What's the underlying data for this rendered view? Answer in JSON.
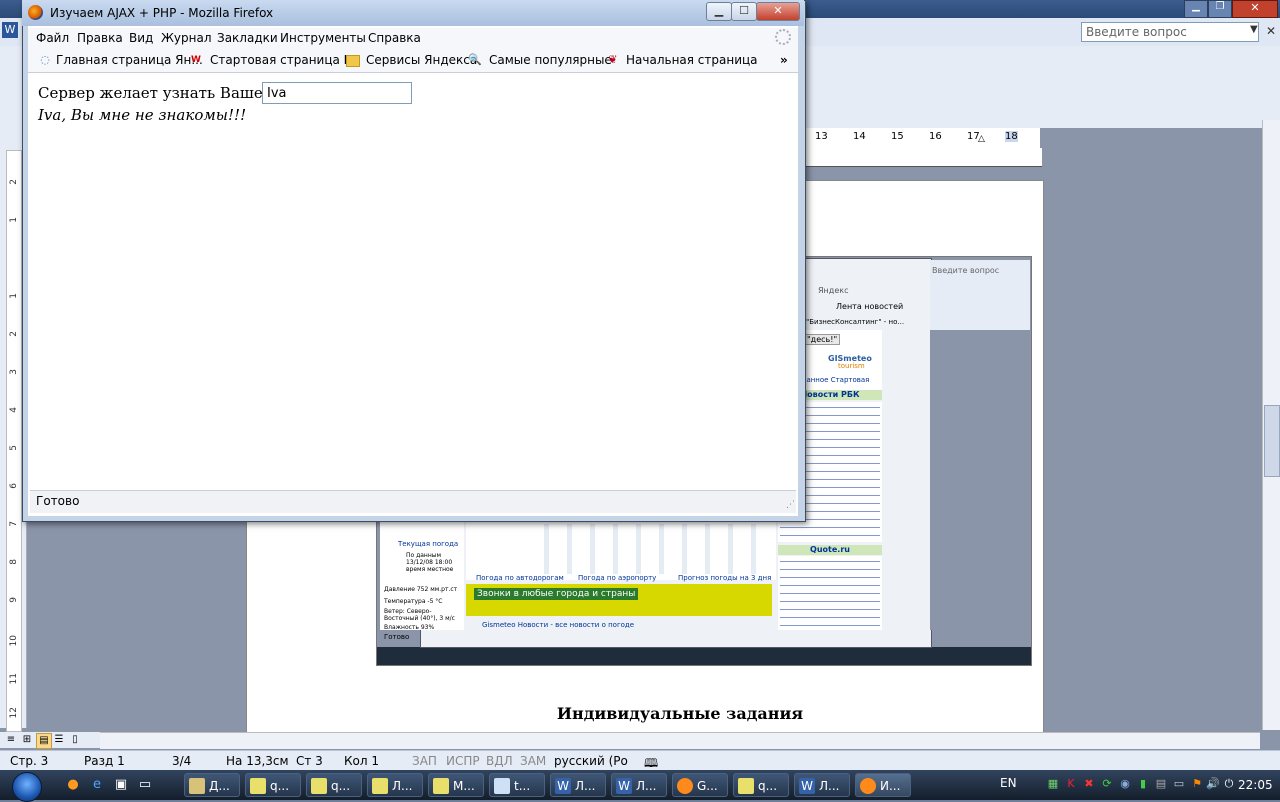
{
  "word": {
    "help_placeholder": "Введите вопрос",
    "ruler_ticks": [
      "13",
      "14",
      "15",
      "16",
      "17",
      "18"
    ],
    "vruler_ticks": [
      "2",
      "1",
      "1",
      "2",
      "3",
      "4",
      "5",
      "6",
      "7",
      "8",
      "9",
      "10",
      "11",
      "12"
    ],
    "doc_heading": "Индивидуальные задания",
    "status": {
      "page": "Стр. 3",
      "section": "Разд 1",
      "pages": "3/4",
      "at": "На 13,3см",
      "line": "Ст 3",
      "col": "Кол 1",
      "rec": "ЗАП",
      "trk": "ИСПР",
      "ext": "ВДЛ",
      "ovr": "ЗАМ",
      "lang": "русский (Ро"
    }
  },
  "inner_shot": {
    "help": "Введите вопрос",
    "yandex": "Яндекс",
    "news_feed": "Лента новостей",
    "tab": "\"БизнесКонсалтинг\" - но...",
    "gismeteo_button": "\"десь!\"",
    "gismeteo_logo": "GISmeteo",
    "gismeteo_sub": "tourism",
    "links": "ранное   Стартовая",
    "rbk_title": "Новости РБК",
    "quote_title": "Quote.ru",
    "weather_link": "Текущая погода",
    "by_data": "По данным 13/12/08 18:00 время местное",
    "pressure": "Давление 752 мм.рт.ст",
    "temperature": "Температура -5 °С",
    "wind": "Ветер: Северо-Восточный (40°), 3 м/с",
    "humidity": "Влажность 93%",
    "ad_text": "Звонки в любые города и страны",
    "gismeteo_news": "Gismeteo Новости - все новости о погоде",
    "forecast_roads": "Погода по автодорогам",
    "forecast_airport": "Погода по аэропорту",
    "forecast_3days": "Прогноз погоды на 3 дня",
    "status": "Готово"
  },
  "firefox": {
    "title": "Изучаем AJAX + PHP - Mozilla Firefox",
    "menu": [
      "Файл",
      "Правка",
      "Вид",
      "Журнал",
      "Закладки",
      "Инструменты",
      "Справка"
    ],
    "bookmarks": [
      {
        "icon": "globe-icon",
        "label": "Главная страница Ян..."
      },
      {
        "icon": "wiki-icon",
        "label": "Стартовая страница F..."
      },
      {
        "icon": "folder-icon",
        "label": "Сервисы Яндекса"
      },
      {
        "icon": "search-icon",
        "label": "Самые популярные"
      },
      {
        "icon": "bird-icon",
        "label": "Начальная страница"
      }
    ],
    "prompt": "Сервер желает узнать Ваше Имя:",
    "input_value": "Iva",
    "reply": "Iva, Вы мне не знакомы!!!",
    "status": "Готово"
  },
  "taskbar": {
    "items": [
      {
        "label": "Д...",
        "icon": "folder-icon"
      },
      {
        "label": "q...",
        "icon": "document-icon"
      },
      {
        "label": "q...",
        "icon": "document-icon"
      },
      {
        "label": "Л...",
        "icon": "document-icon"
      },
      {
        "label": "М...",
        "icon": "document-icon"
      },
      {
        "label": "t...",
        "icon": "document-icon"
      },
      {
        "label": "Л...",
        "icon": "word-icon"
      },
      {
        "label": "Л...",
        "icon": "word-icon"
      },
      {
        "label": "G...",
        "icon": "firefox-icon"
      },
      {
        "label": "q...",
        "icon": "document-icon"
      },
      {
        "label": "Л...",
        "icon": "word-icon"
      },
      {
        "label": "И...",
        "icon": "firefox-icon"
      }
    ],
    "lang": "EN",
    "clock": "22:05"
  }
}
